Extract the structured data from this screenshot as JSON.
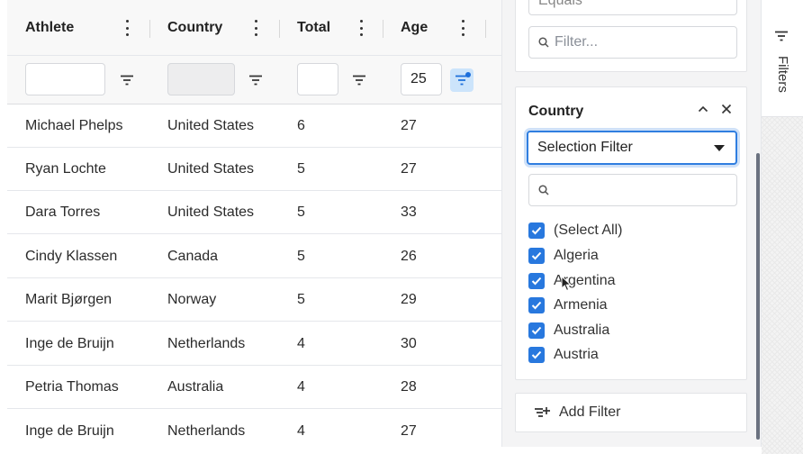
{
  "grid": {
    "columns": [
      {
        "key": "athlete",
        "label": "Athlete"
      },
      {
        "key": "country",
        "label": "Country"
      },
      {
        "key": "total",
        "label": "Total"
      },
      {
        "key": "age",
        "label": "Age"
      }
    ],
    "filters": {
      "athlete": "",
      "country": "",
      "total": "",
      "age": "25"
    },
    "rows": [
      {
        "athlete": "Michael Phelps",
        "country": "United States",
        "total": "6",
        "age": "27"
      },
      {
        "athlete": "Ryan Lochte",
        "country": "United States",
        "total": "5",
        "age": "27"
      },
      {
        "athlete": "Dara Torres",
        "country": "United States",
        "total": "5",
        "age": "33"
      },
      {
        "athlete": "Cindy Klassen",
        "country": "Canada",
        "total": "5",
        "age": "26"
      },
      {
        "athlete": "Marit Bjørgen",
        "country": "Norway",
        "total": "5",
        "age": "29"
      },
      {
        "athlete": "Inge de Bruijn",
        "country": "Netherlands",
        "total": "4",
        "age": "30"
      },
      {
        "athlete": "Petria Thomas",
        "country": "Australia",
        "total": "4",
        "age": "28"
      },
      {
        "athlete": "Inge de Bruijn",
        "country": "Netherlands",
        "total": "4",
        "age": "27"
      }
    ]
  },
  "panel": {
    "top_select_value": "Equals",
    "top_filter_placeholder": "Filter...",
    "country_card": {
      "title": "Country",
      "filter_type": "Selection Filter",
      "search_placeholder": "",
      "options": [
        "(Select All)",
        "Algeria",
        "Argentina",
        "Armenia",
        "Australia",
        "Austria"
      ]
    },
    "add_filter_label": "Add Filter"
  },
  "sidebar": {
    "tab_label": "Filters"
  },
  "colors": {
    "accent": "#2878de",
    "active_filter_bg": "#cce4fb"
  }
}
